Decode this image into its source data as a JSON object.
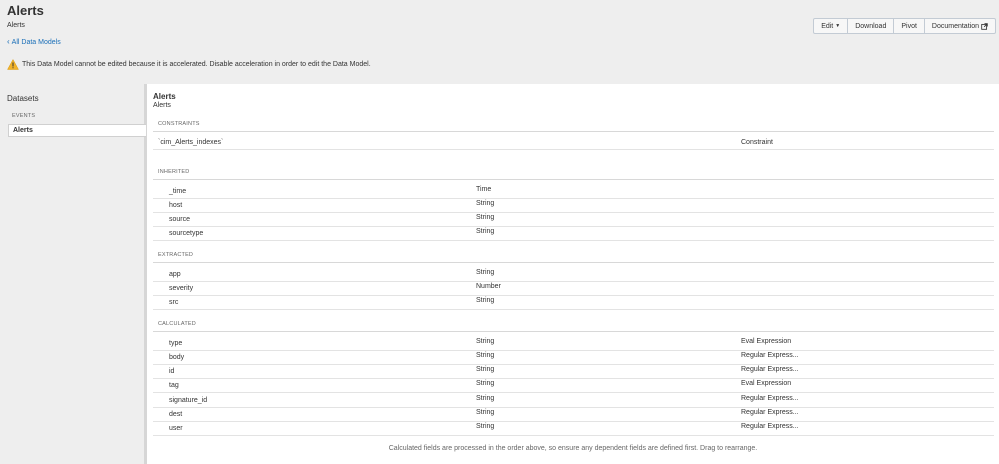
{
  "header": {
    "title": "Alerts",
    "subtitle": "Alerts",
    "back_link": "All Data Models",
    "buttons": {
      "edit": "Edit",
      "download": "Download",
      "pivot": "Pivot",
      "documentation": "Documentation"
    },
    "warning": "This Data Model cannot be edited because it is accelerated. Disable acceleration in order to edit the Data Model."
  },
  "sidebar": {
    "title": "Datasets",
    "group": "EVENTS",
    "item": "Alerts"
  },
  "main": {
    "dataset_title": "Alerts",
    "dataset_subtitle": "Alerts",
    "constraints": {
      "label": "CONSTRAINTS",
      "rows": [
        {
          "name": "`cim_Alerts_indexes`",
          "type": "Constraint"
        }
      ]
    },
    "inherited": {
      "label": "INHERITED",
      "rows": [
        {
          "name": "_time",
          "type": "Time"
        },
        {
          "name": "host",
          "type": "String"
        },
        {
          "name": "source",
          "type": "String"
        },
        {
          "name": "sourcetype",
          "type": "String"
        }
      ]
    },
    "extracted": {
      "label": "EXTRACTED",
      "rows": [
        {
          "name": "app",
          "type": "String"
        },
        {
          "name": "severity",
          "type": "Number"
        },
        {
          "name": "src",
          "type": "String"
        }
      ]
    },
    "calculated": {
      "label": "CALCULATED",
      "rows": [
        {
          "name": "type",
          "type": "String",
          "extra": "Eval Expression"
        },
        {
          "name": "body",
          "type": "String",
          "extra": "Regular Express..."
        },
        {
          "name": "id",
          "type": "String",
          "extra": "Regular Express..."
        },
        {
          "name": "tag",
          "type": "String",
          "extra": "Eval Expression"
        },
        {
          "name": "signature_id",
          "type": "String",
          "extra": "Regular Express..."
        },
        {
          "name": "dest",
          "type": "String",
          "extra": "Regular Express..."
        },
        {
          "name": "user",
          "type": "String",
          "extra": "Regular Express..."
        }
      ]
    },
    "footer_note": "Calculated fields are processed in the order above, so ensure any dependent fields are defined first. Drag to rearrange."
  }
}
